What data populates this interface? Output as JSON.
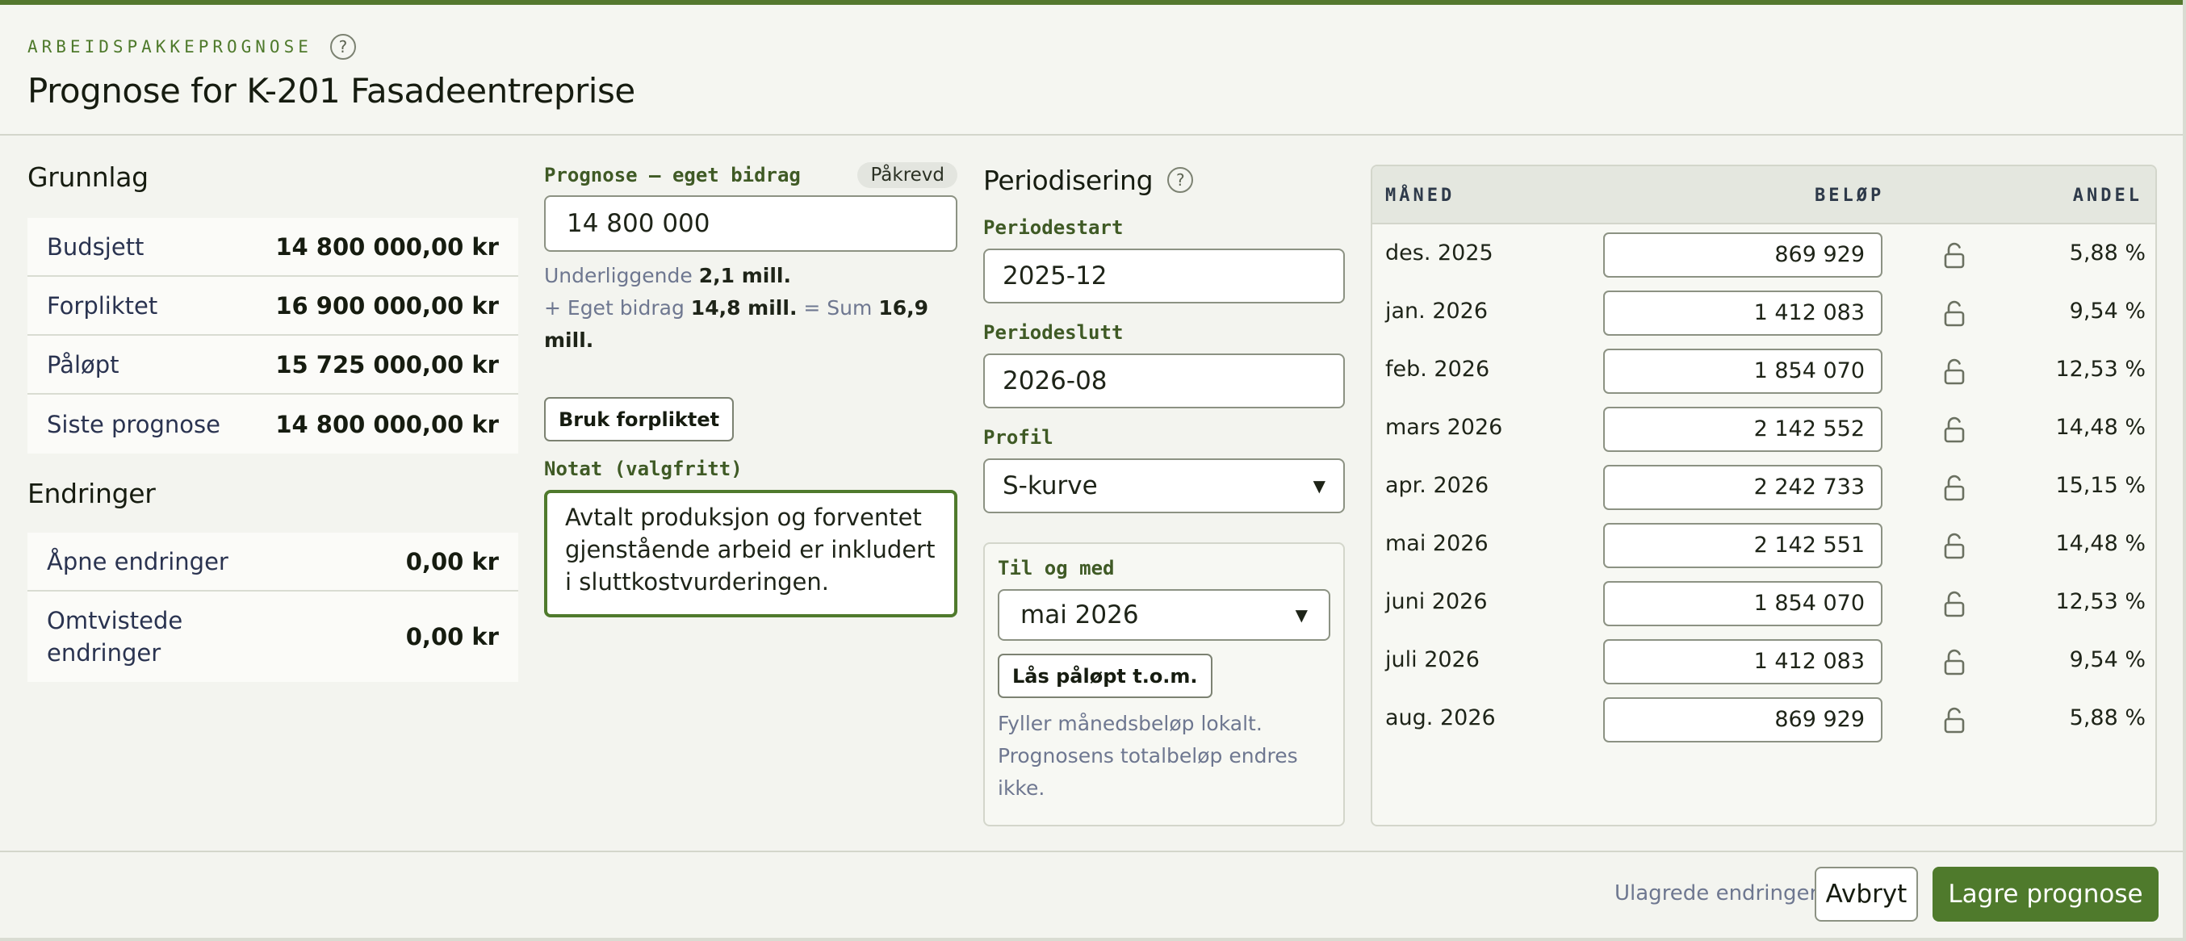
{
  "header": {
    "eyebrow": "ARBEIDSPAKKEPROGNOSE",
    "help": "?",
    "title": "Prognose for K-201 Fasadeentreprise"
  },
  "grunnlag": {
    "heading": "Grunnlag",
    "rows": [
      {
        "label": "Budsjett",
        "value": "14 800 000,00 kr"
      },
      {
        "label": "Forpliktet",
        "value": "16 900 000,00 kr"
      },
      {
        "label": "Påløpt",
        "value": "15 725 000,00 kr"
      },
      {
        "label": "Siste prognose",
        "value": "14 800 000,00 kr"
      }
    ]
  },
  "endringer": {
    "heading": "Endringer",
    "rows": [
      {
        "label": "Åpne endringer",
        "value": "0,00 kr"
      },
      {
        "label": "Omtvistede endringer",
        "value": "0,00 kr"
      }
    ]
  },
  "bidrag": {
    "label": "Prognose – eget bidrag",
    "badge": "Påkrevd",
    "value": "14 800 000",
    "underliggende_label": "Underliggende",
    "underliggende_value": "2,1 mill.",
    "eget_label": "+ Eget bidrag",
    "eget_value": "14,8 mill.",
    "sum_label": "= Sum",
    "sum_value": "16,9 mill.",
    "use_button": "Bruk forpliktet",
    "note_label": "Notat (valgfritt)",
    "note_value": "Avtalt produksjon og forventet gjenstående arbeid er inkludert i sluttkostvurderingen."
  },
  "periodisering": {
    "heading": "Periodisering",
    "start_label": "Periodestart",
    "start_value": "2025-12",
    "end_label": "Periodeslutt",
    "end_value": "2026-08",
    "profile_label": "Profil",
    "profile_value": "S-kurve",
    "tom_label": "Til og med",
    "tom_value": "mai 2026",
    "lock_button": "Lås påløpt t.o.m.",
    "hint": "Fyller månedsbeløp lokalt. Prognosens totalbeløp endres ikke."
  },
  "table": {
    "col_month": "MÅNED",
    "col_amount": "BELØP",
    "col_share": "ANDEL",
    "rows": [
      {
        "month": "des. 2025",
        "amount": "869 929",
        "share": "5,88 %"
      },
      {
        "month": "jan. 2026",
        "amount": "1 412 083",
        "share": "9,54 %"
      },
      {
        "month": "feb. 2026",
        "amount": "1 854 070",
        "share": "12,53 %"
      },
      {
        "month": "mars 2026",
        "amount": "2 142 552",
        "share": "14,48 %"
      },
      {
        "month": "apr. 2026",
        "amount": "2 242 733",
        "share": "15,15 %"
      },
      {
        "month": "mai 2026",
        "amount": "2 142 551",
        "share": "14,48 %"
      },
      {
        "month": "juni 2026",
        "amount": "1 854 070",
        "share": "12,53 %"
      },
      {
        "month": "juli 2026",
        "amount": "1 412 083",
        "share": "9,54 %"
      },
      {
        "month": "aug. 2026",
        "amount": "869 929",
        "share": "5,88 %"
      }
    ]
  },
  "footer": {
    "status": "Ulagrede endringer",
    "cancel": "Avbryt",
    "save": "Lagre prognose"
  },
  "colors": {
    "accent": "#4f7a2c",
    "top_bar": "#54782f",
    "background": "#f3f4ef"
  }
}
